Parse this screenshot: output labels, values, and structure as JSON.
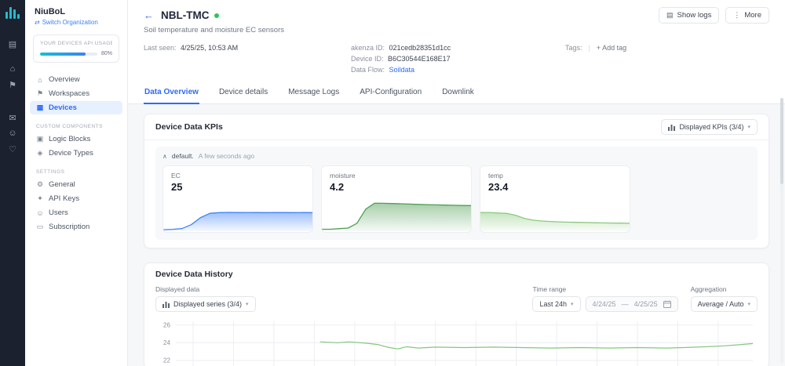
{
  "colors": {
    "accent": "#2f6bf6",
    "status_green": "#2fc25b",
    "rail_bg": "#1b212e",
    "logo_teal": "#27b9cc"
  },
  "ui": {
    "chevron_down": "▾",
    "collapse_up": "∧",
    "divider": "|"
  },
  "rail": {
    "icons": [
      {
        "name": "panel-icon",
        "glyph": "▤"
      },
      {
        "name": "home-icon",
        "glyph": "⌂"
      },
      {
        "name": "flag-icon",
        "glyph": "⚑"
      },
      {
        "name": "chat-icon",
        "glyph": "✉"
      },
      {
        "name": "user-icon",
        "glyph": "☺"
      },
      {
        "name": "help-icon",
        "glyph": "♡"
      }
    ]
  },
  "sidebar": {
    "org_name": "NiuBoL",
    "switch_icon": "⇄",
    "switch_label": "Switch Organization",
    "usage": {
      "label": "YOUR DEVICES API USAGE",
      "percent": "80%"
    },
    "nav": [
      {
        "icon": "⌂",
        "label": "Overview",
        "active": false
      },
      {
        "icon": "⚑",
        "label": "Workspaces",
        "active": false
      },
      {
        "icon": "▦",
        "label": "Devices",
        "active": true
      }
    ],
    "sections": [
      {
        "title": "CUSTOM COMPONENTS",
        "items": [
          {
            "icon": "▣",
            "label": "Logic Blocks"
          },
          {
            "icon": "◈",
            "label": "Device Types"
          }
        ]
      },
      {
        "title": "SETTINGS",
        "items": [
          {
            "icon": "⚙",
            "label": "General"
          },
          {
            "icon": "✦",
            "label": "API Keys"
          },
          {
            "icon": "☺",
            "label": "Users"
          },
          {
            "icon": "▭",
            "label": "Subscription"
          }
        ]
      }
    ]
  },
  "header": {
    "back": "←",
    "title": "NBL-TMC",
    "logs_icon": "▤",
    "show_logs": "Show logs",
    "more_icon": "⋮",
    "more": "More",
    "subtitle": "Soil temperature and moisture EC sensors",
    "last_seen_label": "Last seen:",
    "last_seen_value": "4/25/25, 10:53 AM",
    "akenza_id_label": "akenza ID:",
    "akenza_id_value": "021cedb28351d1cc",
    "device_id_label": "Device ID:",
    "device_id_value": "B6C30544E168E17",
    "data_flow_label": "Data Flow:",
    "data_flow_value": "Soildata",
    "tags_label": "Tags:",
    "add_tag": "+ Add tag"
  },
  "tabs": [
    {
      "label": "Data Overview",
      "active": true
    },
    {
      "label": "Device details",
      "active": false
    },
    {
      "label": "Message Logs",
      "active": false
    },
    {
      "label": "API-Configuration",
      "active": false
    },
    {
      "label": "Downlink",
      "active": false
    }
  ],
  "kpis": {
    "title": "Device Data KPIs",
    "selector": "Displayed KPIs (3/4)",
    "group_name": "default.",
    "group_time": "A few seconds ago",
    "cards": [
      {
        "label": "EC",
        "value": "25"
      },
      {
        "label": "moisture",
        "value": "4.2"
      },
      {
        "label": "temp",
        "value": "23.4"
      }
    ]
  },
  "history": {
    "title": "Device Data History",
    "displayed_data_label": "Displayed data",
    "series_selector": "Displayed series (3/4)",
    "time_range_label": "Time range",
    "time_range_value": "Last 24h",
    "date_from": "4/24/25",
    "date_sep": "—",
    "date_to": "4/25/25",
    "aggregation_label": "Aggregation",
    "aggregation_value": "Average / Auto"
  },
  "chart_data": [
    {
      "id": "ec",
      "type": "area",
      "title": "EC sparkline",
      "current": 25,
      "color": "#3f83f8",
      "ymin": 0,
      "ymax": 44,
      "values": [
        1,
        1.5,
        2.5,
        8,
        18,
        24,
        25,
        25.3,
        25.1,
        25.2,
        25.1,
        25,
        25.2,
        25.1,
        25,
        25.1,
        25
      ]
    },
    {
      "id": "moisture",
      "type": "area",
      "title": "moisture sparkline",
      "current": 4.2,
      "color": "#4f9e55",
      "ymin": 0,
      "ymax": 5.3,
      "values": [
        0.2,
        0.2,
        0.3,
        0.4,
        1.2,
        3.6,
        4.6,
        4.58,
        4.55,
        4.5,
        4.45,
        4.4,
        4.36,
        4.32,
        4.28,
        4.25,
        4.22,
        4.2
      ]
    },
    {
      "id": "temp",
      "type": "area",
      "title": "temp sparkline",
      "current": 23.4,
      "color": "#8cc97f",
      "ymin": 22.6,
      "ymax": 26.1,
      "values": [
        24.6,
        24.6,
        24.55,
        24.5,
        24.3,
        23.95,
        23.75,
        23.65,
        23.6,
        23.55,
        23.52,
        23.5,
        23.48,
        23.46,
        23.44,
        23.42,
        23.41,
        23.4
      ]
    },
    {
      "id": "history",
      "type": "line",
      "title": "Device Data History",
      "ylabel": "",
      "xlabel": "",
      "color": "#84c67e",
      "yticks": [
        26,
        24,
        22
      ],
      "y_top_value": 26.6,
      "y_bottom_value": 21.1,
      "grid_x": [
        0.03,
        0.1,
        0.17,
        0.24,
        0.31,
        0.38,
        0.45,
        0.52,
        0.59,
        0.66,
        0.73,
        0.8,
        0.87,
        0.94
      ],
      "points": [
        [
          0.25,
          24.1
        ],
        [
          0.28,
          24.0
        ],
        [
          0.3,
          24.1
        ],
        [
          0.33,
          23.95
        ],
        [
          0.35,
          23.8
        ],
        [
          0.37,
          23.45
        ],
        [
          0.385,
          23.3
        ],
        [
          0.4,
          23.55
        ],
        [
          0.42,
          23.4
        ],
        [
          0.45,
          23.5
        ],
        [
          0.5,
          23.45
        ],
        [
          0.55,
          23.5
        ],
        [
          0.6,
          23.45
        ],
        [
          0.65,
          23.4
        ],
        [
          0.7,
          23.45
        ],
        [
          0.75,
          23.4
        ],
        [
          0.8,
          23.45
        ],
        [
          0.85,
          23.4
        ],
        [
          0.88,
          23.45
        ],
        [
          0.92,
          23.55
        ],
        [
          0.95,
          23.65
        ],
        [
          0.98,
          23.8
        ],
        [
          1,
          23.9
        ]
      ]
    }
  ]
}
